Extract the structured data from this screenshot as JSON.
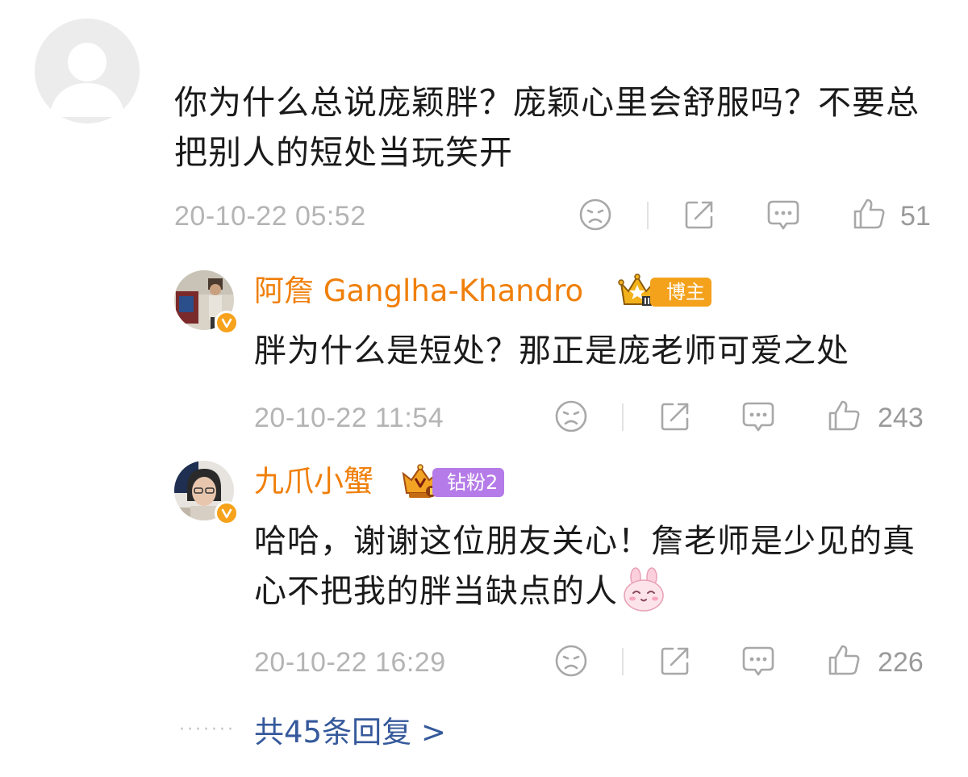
{
  "comment": {
    "text": "你为什么总说庞颖胖？庞颖心里会舒服吗？不要总把别人的短处当玩笑开",
    "timestamp": "20-10-22 05:52",
    "likes": "51"
  },
  "replies": [
    {
      "username": "阿詹 Ganglha-Khandro",
      "badge": "博主",
      "text": "胖为什么是短处？那正是庞老师可爱之处",
      "timestamp": "20-10-22 11:54",
      "likes": "243"
    },
    {
      "username": "九爪小蟹",
      "badge": "钻粉2",
      "text": "哈哈，谢谢这位朋友关心！詹老师是少见的真心不把我的胖当缺点的人",
      "timestamp": "20-10-22 16:29",
      "likes": "226"
    }
  ],
  "more": {
    "dots": "·······",
    "label": "共45条回复 >"
  },
  "colors": {
    "username": "#f07f0a",
    "link": "#35599b",
    "meta": "#b4b4b4",
    "icon": "#a8a8a8",
    "badge_blogger": "#f4a21c",
    "badge_fan": "#b57be8"
  },
  "icons": [
    "sad-face-icon",
    "share-icon",
    "comment-icon",
    "thumbs-up-icon",
    "verified-icon",
    "crown-icon",
    "bunny-emoji-icon"
  ]
}
